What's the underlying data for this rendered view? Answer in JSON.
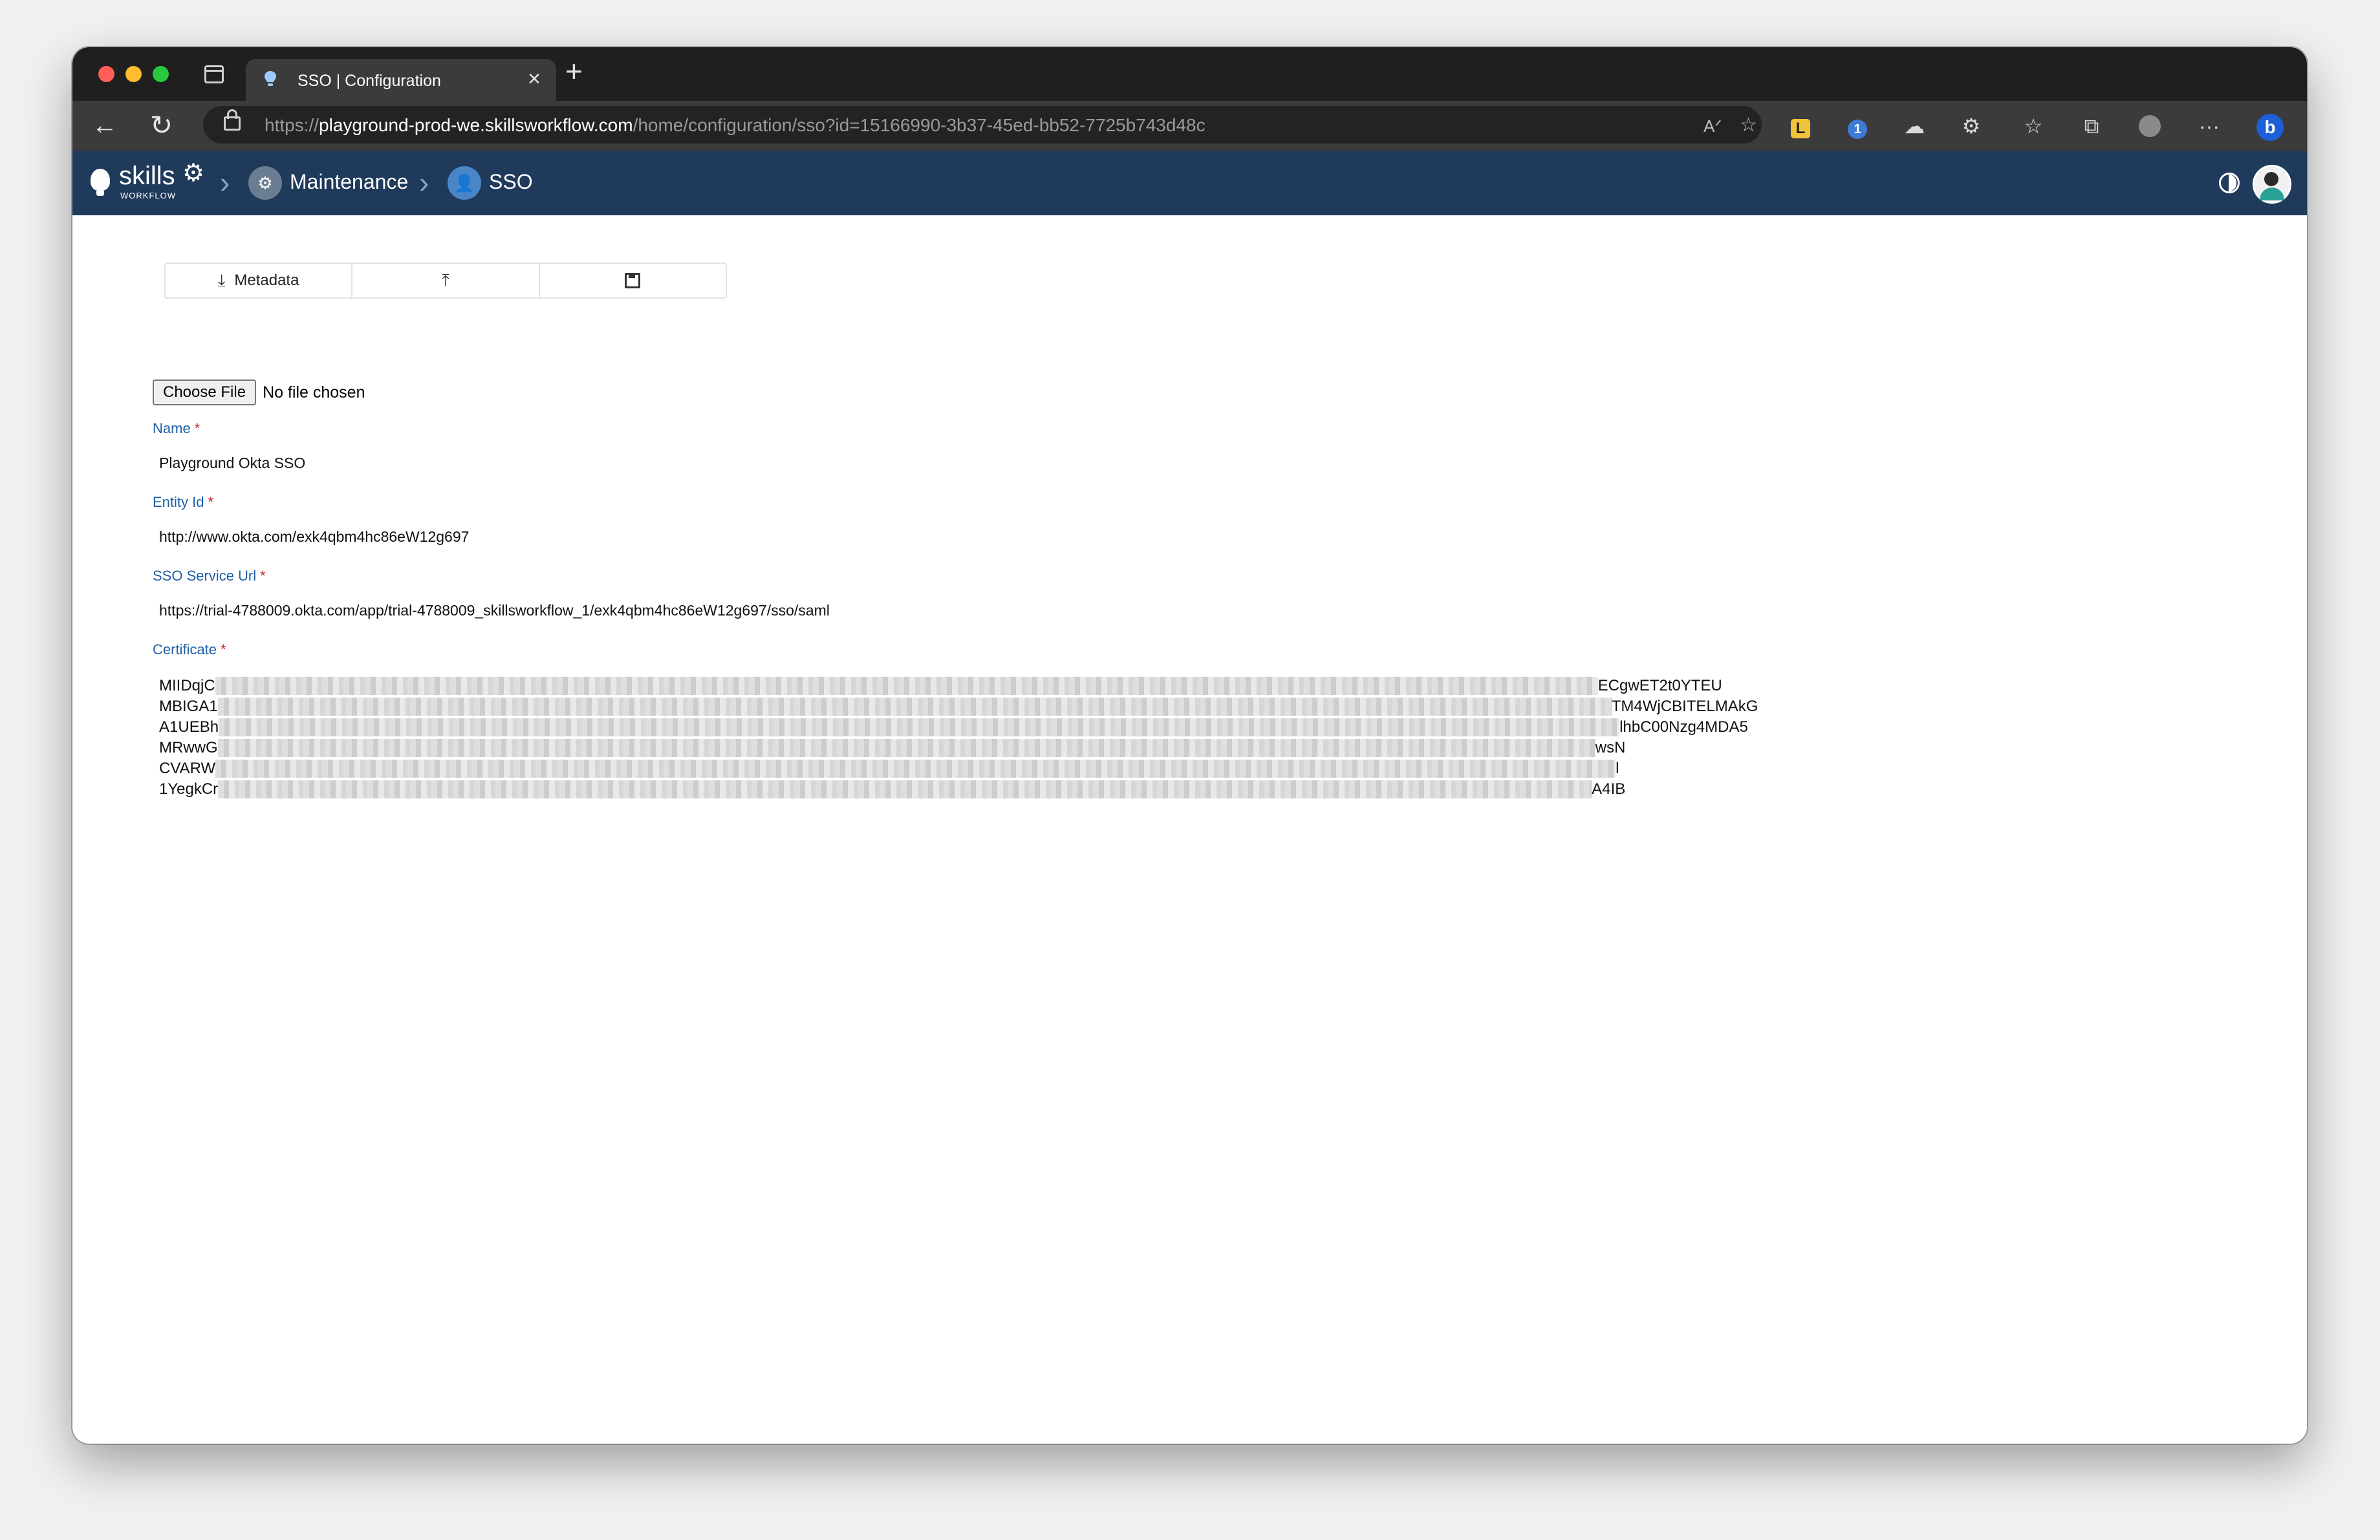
{
  "browser": {
    "tab_title": "SSO | Configuration",
    "url_prefix": "https://",
    "url_host": "playground-prod-we.skillsworkflow.com",
    "url_path": "/home/configuration/sso?id=15166990-3b37-45ed-bb52-7725b743d48c",
    "close_glyph": "×",
    "new_tab_glyph": "+",
    "back_glyph": "←",
    "refresh_glyph": "↻",
    "read_aloud_glyph": "Aᐟ",
    "favorite_add_glyph": "☆",
    "extensions": {
      "l_glyph": "L",
      "onepassword_glyph": "1",
      "cloud_glyph": "☁",
      "puzzle_glyph": "⚙",
      "favorites_glyph": "☆",
      "collections_glyph": "⧉",
      "more_glyph": "···",
      "bing_glyph": "b"
    }
  },
  "app": {
    "logo_text": "skills",
    "logo_sub": "WORKFLOW",
    "logo_gear": "⚙",
    "breadcrumb_sep": "›",
    "breadcrumbs": [
      {
        "label": "Maintenance",
        "icon": "⚙"
      },
      {
        "label": "SSO",
        "icon": "👤"
      }
    ]
  },
  "toolbar": {
    "metadata_label": "Metadata",
    "download_icon": "⤓",
    "upload_icon": "⤒"
  },
  "file_input": {
    "button_label": "Choose File",
    "status": "No file chosen"
  },
  "form": {
    "required_mark": "*",
    "name": {
      "label": "Name",
      "value": "Playground Okta SSO"
    },
    "entity_id": {
      "label": "Entity Id",
      "value": "http://www.okta.com/exk4qbm4hc86eW12g697"
    },
    "sso_service_url": {
      "label": "SSO Service Url",
      "value": "https://trial-4788009.okta.com/app/trial-4788009_skillsworkflow_1/exk4qbm4hc86eW12g697/sso/saml"
    },
    "certificate": {
      "label": "Certificate",
      "lines": [
        {
          "start": "MIIDqjC",
          "end": "ECgwET2t0YTEU"
        },
        {
          "start": "MBIGA1",
          "end": "TM4WjCBITELMAkG"
        },
        {
          "start": "A1UEBh",
          "end": "lhbC00Nzg4MDA5"
        },
        {
          "start": "MRwwG",
          "end": "wsN"
        },
        {
          "start": "CVARW",
          "end": "l"
        },
        {
          "start": "1YegkCr",
          "end": "A4IB"
        }
      ]
    }
  }
}
